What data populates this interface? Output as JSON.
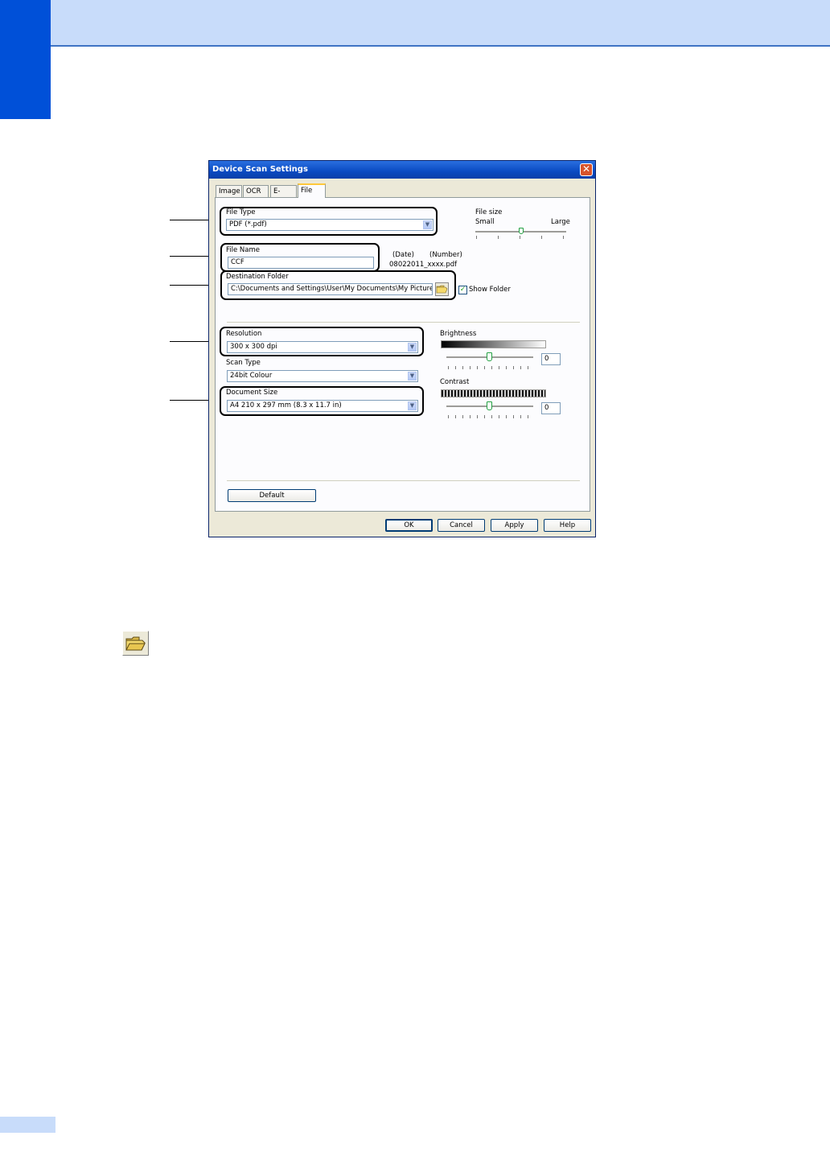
{
  "dialog": {
    "title": "Device Scan Settings",
    "close_glyph": "✕",
    "tabs": [
      {
        "label": "Image"
      },
      {
        "label": "OCR"
      },
      {
        "label": "E-mail"
      },
      {
        "label": "File"
      }
    ],
    "file_type": {
      "label": "File Type",
      "value": "PDF (*.pdf)"
    },
    "file_size": {
      "label": "File size",
      "min_label": "Small",
      "max_label": "Large",
      "level": 0.5
    },
    "file_name": {
      "label": "File Name",
      "value": "CCF",
      "date_label": "(Date)",
      "number_label": "(Number)",
      "example": "08022011_xxxx.pdf"
    },
    "destination_folder": {
      "label": "Destination Folder",
      "value": "C:\\Documents and Settings\\User\\My Documents\\My Pictures\\Cc",
      "show_folder_label": "Show Folder",
      "show_folder_checked": true
    },
    "resolution": {
      "label": "Resolution",
      "value": "300 x 300 dpi"
    },
    "scan_type": {
      "label": "Scan Type",
      "value": "24bit Colour"
    },
    "document_size": {
      "label": "Document Size",
      "value": "A4 210 x 297 mm (8.3 x 11.7 in)"
    },
    "brightness": {
      "label": "Brightness",
      "value": "0"
    },
    "contrast": {
      "label": "Contrast",
      "value": "0"
    },
    "buttons": {
      "default": "Default",
      "ok": "OK",
      "cancel": "Cancel",
      "apply": "Apply",
      "help": "Help"
    },
    "dropdown_glyph": "▼",
    "check_glyph": "✓"
  },
  "colors": {
    "header_band": "#c8dcfa",
    "side_tab": "#0050d8",
    "title_bar": "#0a4ac2",
    "tab_highlight": "#ffc83c"
  },
  "icons": [
    "folder-icon",
    "close-icon",
    "chevron-down-icon",
    "checkmark-icon"
  ]
}
